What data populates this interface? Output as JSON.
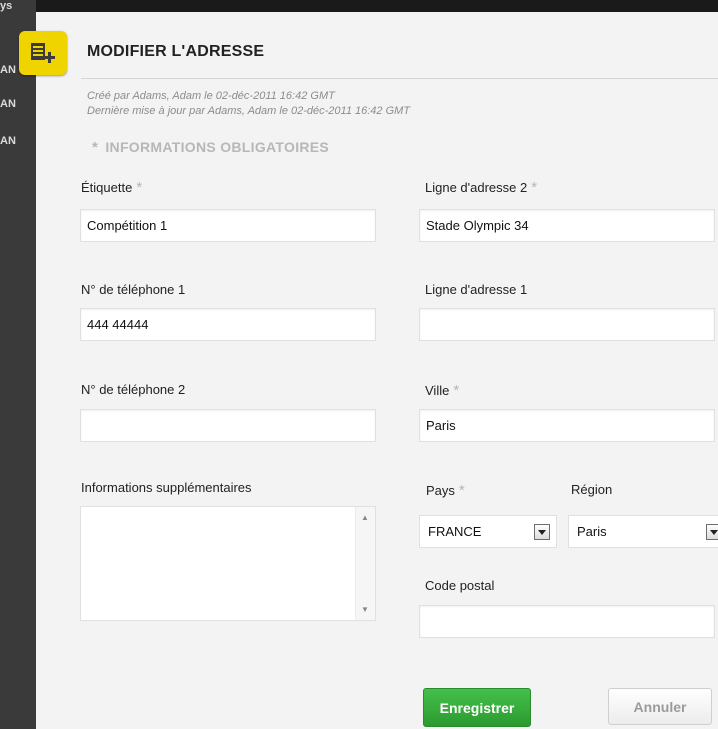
{
  "background": {
    "fragments": [
      "ys",
      "AN",
      "AN",
      "AN"
    ]
  },
  "dialog": {
    "title": "MODIFIER L'ADRESSE",
    "created_by": "Créé par Adams, Adam le 02-déc-2011 16:42 GMT",
    "updated_by": "Dernière mise à jour par Adams, Adam le 02-déc-2011 16:42 GMT",
    "required_section": "INFORMATIONS OBLIGATOIRES",
    "required_star": "*"
  },
  "form": {
    "label_field": {
      "label": "Étiquette",
      "value": "Compétition 1",
      "required": true
    },
    "phone1": {
      "label": "N° de téléphone 1",
      "value": "444 44444"
    },
    "phone2": {
      "label": "N° de téléphone 2",
      "value": ""
    },
    "additional_info": {
      "label": "Informations supplémentaires",
      "value": ""
    },
    "address_line2": {
      "label": "Ligne d'adresse 2",
      "value": "Stade Olympic 34",
      "required": true
    },
    "address_line1": {
      "label": "Ligne d'adresse 1",
      "value": ""
    },
    "city": {
      "label": "Ville",
      "value": "Paris",
      "required": true
    },
    "country": {
      "label": "Pays",
      "value": "FRANCE",
      "required": true
    },
    "region": {
      "label": "Région",
      "value": "Paris"
    },
    "postal_code": {
      "label": "Code postal",
      "value": ""
    }
  },
  "buttons": {
    "save": "Enregistrer",
    "cancel": "Annuler"
  },
  "colors": {
    "accent_yellow": "#f0d400",
    "save_green": "#2c9a31",
    "required_star": "#b5b5b5"
  },
  "icons": {
    "title": "address-book-add-icon",
    "scroll_up": "scroll-up-arrow-icon",
    "scroll_down": "scroll-down-arrow-icon",
    "dropdown": "chevron-down-icon"
  }
}
